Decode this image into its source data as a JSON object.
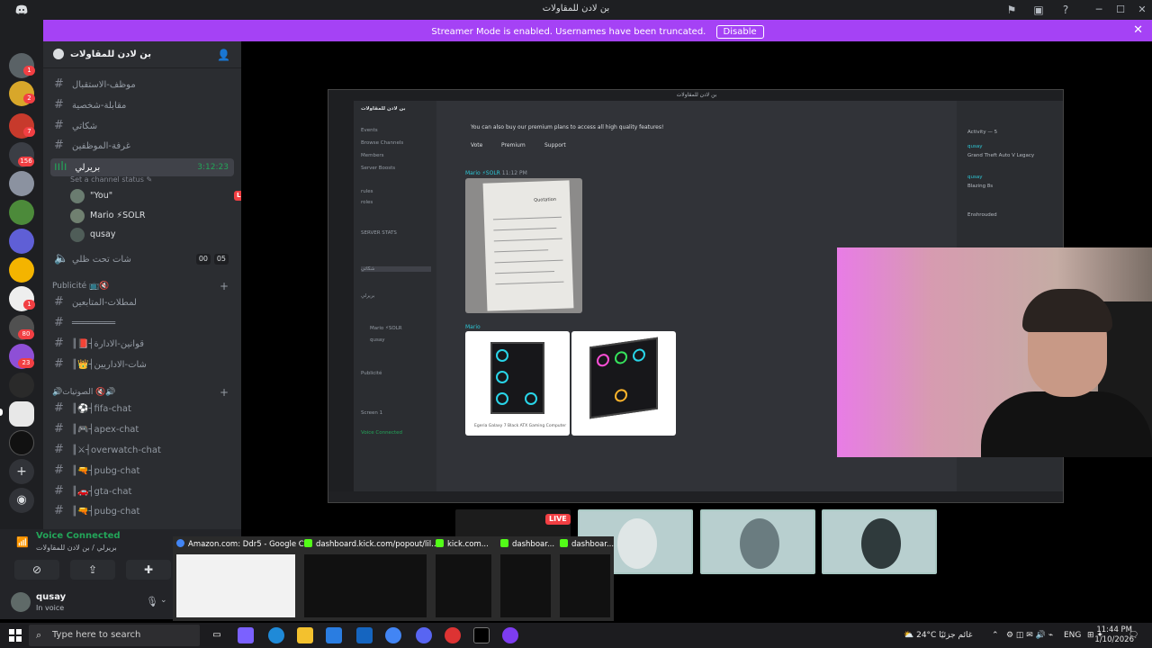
{
  "window": {
    "title": "بن لادن للمقاولات"
  },
  "banner": {
    "text": "Streamer Mode is enabled. Usernames have been truncated.",
    "button": "Disable",
    "color": "#a542f5"
  },
  "server_rail": {
    "badges": [
      "1",
      "2",
      "7",
      "156",
      "1",
      "80",
      "23"
    ]
  },
  "server": {
    "name": "بن لادن للمقاولات"
  },
  "channels": [
    {
      "name": "موظف-الاستقبال"
    },
    {
      "name": "مقابلة-شخصية"
    },
    {
      "name": "شكاتي"
    },
    {
      "name": "غرفة-الموظفين"
    }
  ],
  "voice_channel": {
    "name": "بريرلي",
    "time": "3:12:23",
    "status_placeholder": "Set a channel status",
    "users": [
      {
        "name": "\"You\"",
        "live": "LIVE"
      },
      {
        "name": "Mario",
        "tag": "⚡SOLR"
      },
      {
        "name": "qusay"
      }
    ]
  },
  "afk_channel": {
    "name": "شات تحت ظلي",
    "count_a": "00",
    "count_b": "05"
  },
  "category_pub": {
    "name": "Publicité 📺🔇"
  },
  "pub_channels": [
    {
      "name": "لمطلات-المتابعين"
    },
    {
      "name": "════════"
    },
    {
      "name": "║📕┤قوانين-الادارة"
    },
    {
      "name": "║👑┤شات-الاداريين"
    }
  ],
  "category_voice": {
    "name": "🔊الصوتيات 🔇🔊"
  },
  "voice_channels": [
    {
      "name": "║⚽┤fifa-chat"
    },
    {
      "name": "║🎮┤apex-chat"
    },
    {
      "name": "║⚔┤overwatch-chat"
    },
    {
      "name": "║🔫┤pubg-chat"
    },
    {
      "name": "║🚗┤gta-chat"
    },
    {
      "name": "║🔫┤pubg-chat"
    }
  ],
  "voice_panel": {
    "title": "Voice Connected",
    "channel": "بريرلي / بن لادن للمقاولات",
    "user": "qusay",
    "status": "In voice"
  },
  "stream": {
    "inner_title": "بن لادن للمقاولات",
    "premium_text": "You can also buy our premium plans to access all high quality features!",
    "links": [
      "Vote",
      "Premium",
      "Support"
    ],
    "author": "Mario",
    "author_tag": "⚡SOLR",
    "author_time": "11:12 PM",
    "product_caption": "Egeria Galaxy 7 Black ATX Gaming Computer",
    "inner_sidebar": [
      "Events",
      "Browse Channels",
      "Members",
      "Server Boosts",
      "rules",
      "roles",
      "SERVER STATS",
      "شكاتي",
      "بريرلي",
      "Mario ⚡SOLR",
      "qusay",
      "Publicité",
      "Screen 1",
      "Voice Connected"
    ],
    "activity": [
      "Activity — 5",
      "qusay",
      "Grand Theft Auto V Legacy",
      "qusay",
      "Blazing 8s",
      "Enshrouded"
    ],
    "receipt_title": "Quotation"
  },
  "alt_tab": [
    {
      "label": "Amazon.com: Ddr5 - Google C...",
      "color": "#4285f4"
    },
    {
      "label": "dashboard.kick.com/popout/lil...",
      "color": "#53fc18"
    },
    {
      "label": "kick.com...",
      "color": "#53fc18"
    },
    {
      "label": "dashboar...",
      "color": "#53fc18"
    },
    {
      "label": "dashboar...",
      "color": "#53fc18"
    }
  ],
  "tiles_live": "LIVE",
  "taskbar": {
    "search": "Type here to search",
    "weather": "24°C غائم جزئيًا",
    "lang": "ENG",
    "time": "11:44 PM",
    "date": "1/10/2026"
  }
}
